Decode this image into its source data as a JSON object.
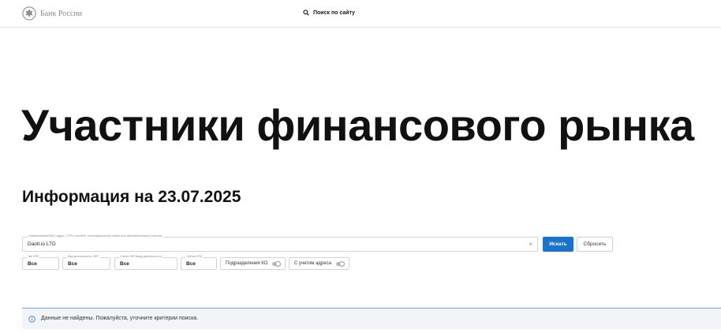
{
  "header": {
    "logo_text": "Банк России",
    "search_label": "Поиск по сайту"
  },
  "page_title": "Участники финансового рынка",
  "info_date": "Информация на 23.07.2025",
  "search": {
    "field_label": "Наименование/ФИО, адрес, ОГРН или ИНН, регистрационный номер или лицензия/запись в реестре",
    "value": "Daotl.io LTD",
    "clear_icon": "×",
    "search_button": "Искать",
    "reset_button": "Сбросить"
  },
  "filters": [
    {
      "label": "Тип УФР",
      "value": "Все"
    },
    {
      "label": "Вид деятельности УФР",
      "value": "Все"
    },
    {
      "label": "Статус УФР/вида деятельности",
      "value": "Все"
    },
    {
      "label": "Субъект РФ",
      "value": "Все"
    }
  ],
  "toggles": [
    {
      "label": "Подразделения КО",
      "on": false
    },
    {
      "label": "С учетом адреса",
      "on": false
    }
  ],
  "result": {
    "icon": "info-icon",
    "message": "Данные не найдены. Пожалуйста, уточните критерии поиска."
  },
  "colors": {
    "accent": "#1a73c9",
    "info": "#3d7fc1",
    "result_bg": "#f2f4f7"
  }
}
